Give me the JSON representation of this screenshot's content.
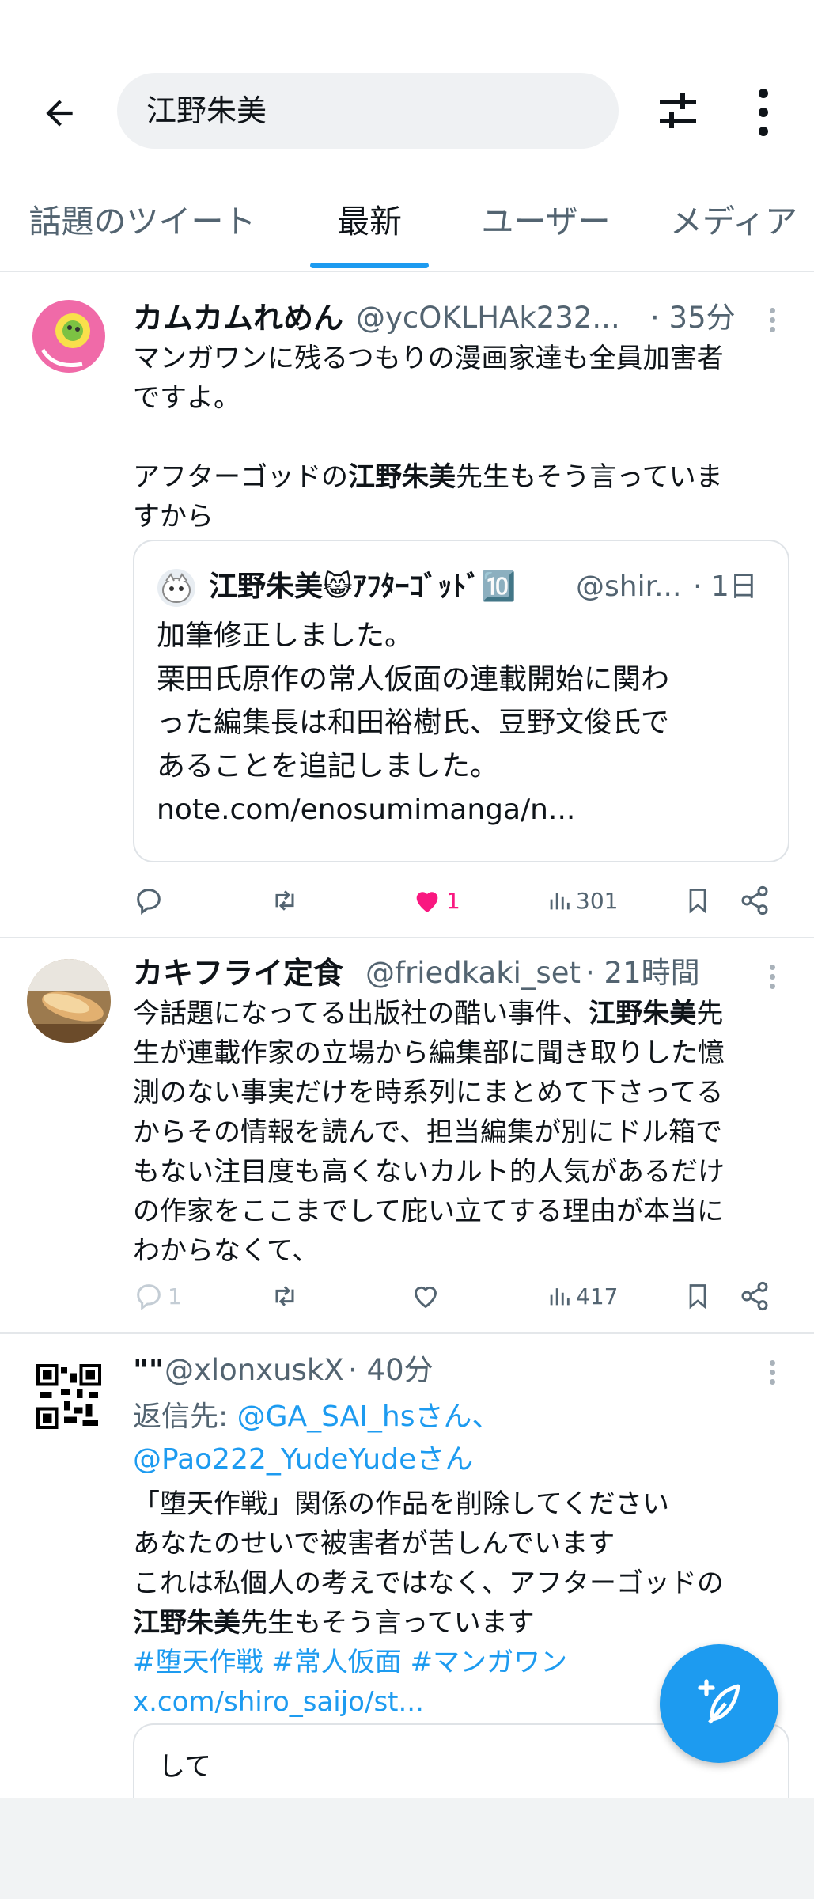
{
  "search": {
    "query": "江野朱美"
  },
  "tabs": [
    {
      "label": "話題のツイート"
    },
    {
      "label": "最新"
    },
    {
      "label": "ユーザー"
    },
    {
      "label": "メディア"
    }
  ],
  "tweets": [
    {
      "name": "カムカムれめん",
      "handle": "@ycOKLHAk232...",
      "time": "· 35分",
      "text_line1": "マンガワンに残るつもりの漫画家達も全員加害者",
      "text_line2": "ですよ。",
      "text_line3_pre": "アフターゴッドの",
      "text_line3_bold": "江野朱美",
      "text_line3_post": "先生もそう言っていま",
      "text_line4": "すから",
      "quote": {
        "name": "江野朱美😸ｱﾌﾀｰｺﾞｯﾄﾞ🔟",
        "handle": "@shir...",
        "time": "· 1日",
        "lines": [
          "加筆修正しました。",
          "栗田氏原作の常人仮面の連載開始に関わ",
          "った編集長は和田裕樹氏、豆野文俊氏で",
          "あることを追記しました。",
          "note.com/enosumimanga/n..."
        ]
      },
      "replies": "",
      "likes": "1",
      "views": "301"
    },
    {
      "name": "カキフライ定食",
      "handle": "@friedkaki_set",
      "time": "· 21時間",
      "line1_pre": "今話題になってる出版社の酷い事件、",
      "line1_bold": "江野朱美",
      "line1_post": "先",
      "lines": [
        "生が連載作家の立場から編集部に聞き取りした憶",
        "測のない事実だけを時系列にまとめて下さってる",
        "からその情報を読んで、担当編集が別にドル箱で",
        "もない注目度も高くないカルト的人気があるだけ",
        "の作家をここまでして庇い立てする理由が本当に",
        "わからなくて、"
      ],
      "replies": "1",
      "views": "417"
    },
    {
      "name": "\"\"",
      "handle": "@xlonxuskX",
      "time": "· 40分",
      "reply_prefix": "返信先:",
      "reply_to1": "@GA_SAI_hsさん、",
      "reply_to2": "@Pao222_YudeYudeさん",
      "lines": [
        "「堕天作戦」関係の作品を削除してください",
        "あなたのせいで被害者が苦しんでいます",
        "これは私個人の考えではなく、アフターゴッドの"
      ],
      "line4_bold": "江野朱美",
      "line4_post": "先生もそう言っています",
      "hashtags": "#堕天作戦 #常人仮面 #マンガワン",
      "link": "x.com/shiro_saijo/st...",
      "quote_preview": "して"
    }
  ],
  "colors": {
    "accent": "#1d9bf0",
    "like": "#f91880"
  }
}
